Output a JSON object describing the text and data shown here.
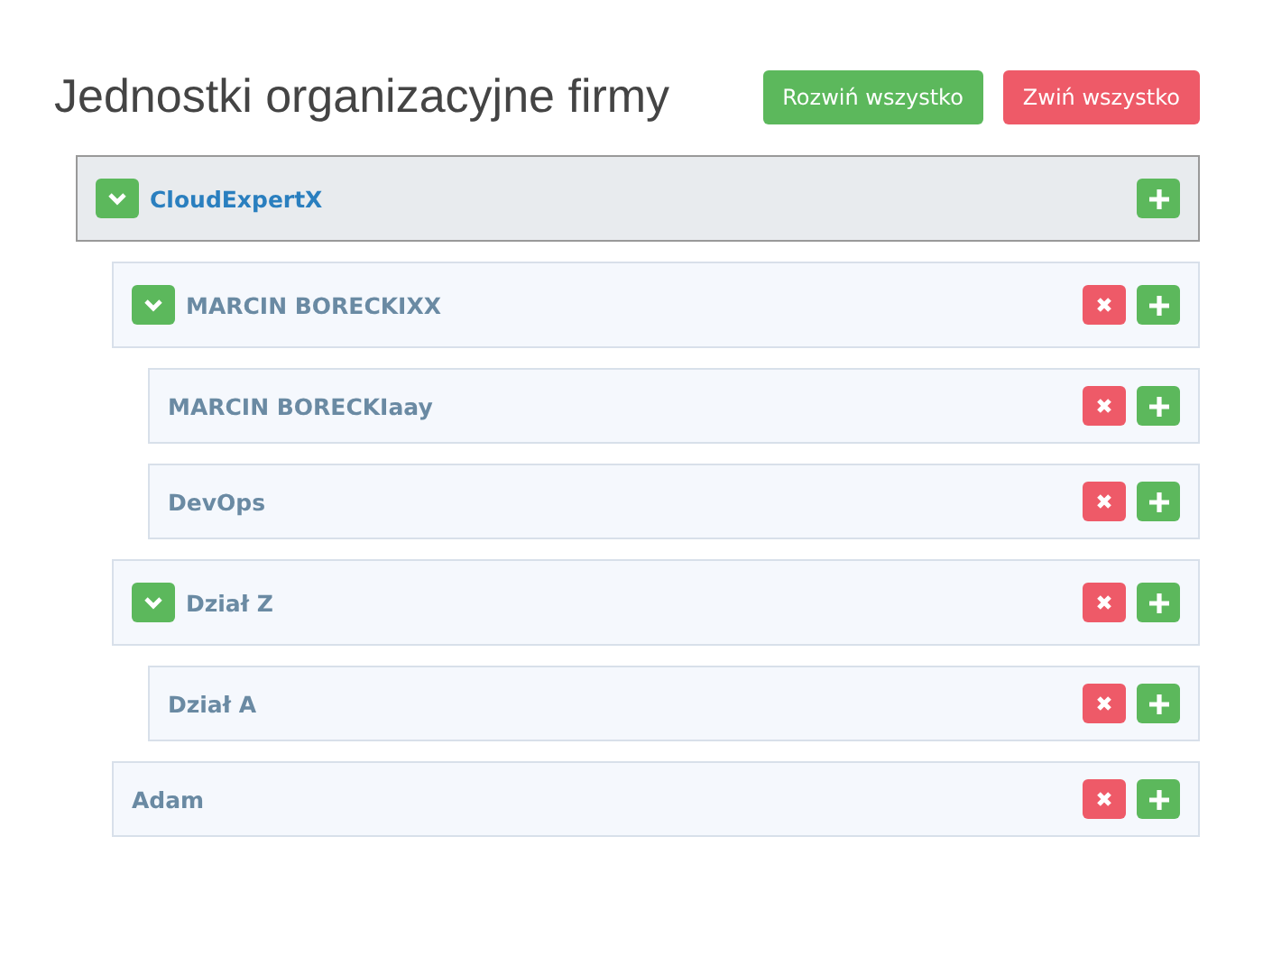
{
  "title": "Jednostki organizacyjne firmy",
  "buttons": [
    {
      "label": "Rozwiń wszystko",
      "kind": "expand"
    },
    {
      "label": "Zwiń wszystko",
      "kind": "collapse"
    }
  ],
  "tree": [
    {
      "name": "CloudExpertX",
      "kind": "root",
      "expanded": true,
      "children": [
        {
          "name": "MARCIN BORECKIXX",
          "kind": "unit",
          "expanded": true,
          "children": [
            {
              "name": "MARCIN BORECKIaay",
              "kind": "unit"
            },
            {
              "name": "DevOps",
              "kind": "unit"
            }
          ]
        },
        {
          "name": "Dział Z",
          "kind": "unit",
          "expanded": true,
          "children": [
            {
              "name": "Dział A",
              "kind": "unit"
            }
          ]
        },
        {
          "name": "Adam",
          "kind": "unit"
        }
      ]
    }
  ]
}
